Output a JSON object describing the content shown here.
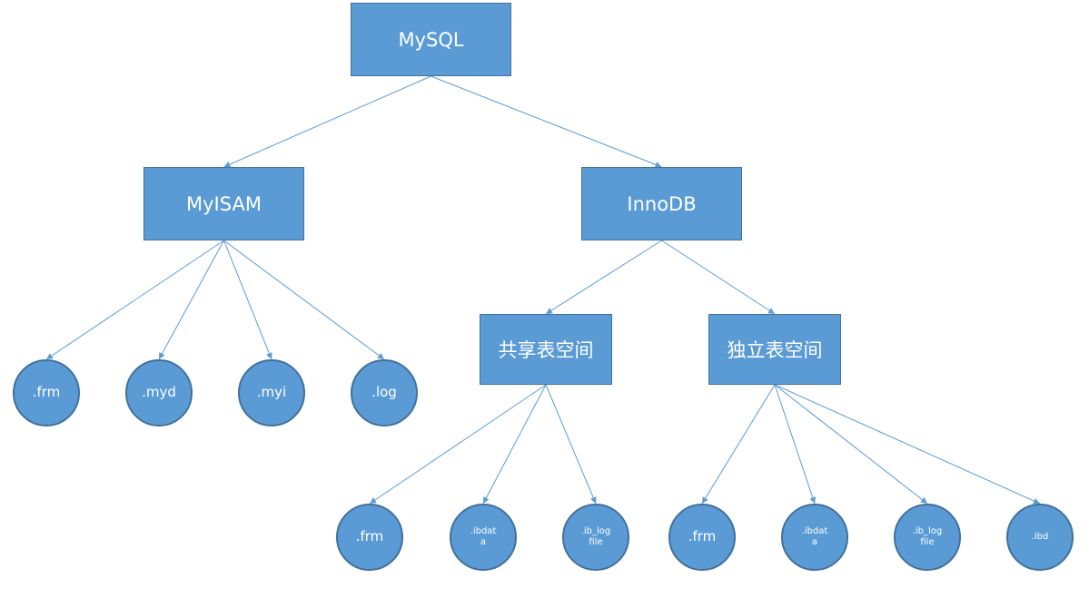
{
  "diagram": {
    "colors": {
      "fill": "#5B9BD5",
      "border": "#41719C",
      "text": "#FFFFFF",
      "edge": "#5B9BD5"
    },
    "nodes": {
      "mysql": {
        "label": "MySQL"
      },
      "myisam": {
        "label": "MyISAM"
      },
      "innodb": {
        "label": "InnoDB"
      },
      "shared_tablespace": {
        "label": "共享表空间"
      },
      "independent_tablespace": {
        "label": "独立表空间"
      },
      "myisam_frm": {
        "label": ".frm"
      },
      "myisam_myd": {
        "label": ".myd"
      },
      "myisam_myi": {
        "label": ".myi"
      },
      "myisam_log": {
        "label": ".log"
      },
      "shared_frm": {
        "label": ".frm"
      },
      "shared_ibdata": {
        "label": ".ibdat\na"
      },
      "shared_ib_logfile": {
        "label": ".ib_log\nfile"
      },
      "independent_frm": {
        "label": ".frm"
      },
      "independent_ibdata": {
        "label": ".ibdat\na"
      },
      "independent_ib_logfile": {
        "label": ".ib_log\nfile"
      },
      "independent_ibd": {
        "label": ".ibd"
      }
    },
    "edges": [
      [
        "mysql",
        "myisam"
      ],
      [
        "mysql",
        "innodb"
      ],
      [
        "myisam",
        "myisam_frm"
      ],
      [
        "myisam",
        "myisam_myd"
      ],
      [
        "myisam",
        "myisam_myi"
      ],
      [
        "myisam",
        "myisam_log"
      ],
      [
        "innodb",
        "shared_tablespace"
      ],
      [
        "innodb",
        "independent_tablespace"
      ],
      [
        "shared_tablespace",
        "shared_frm"
      ],
      [
        "shared_tablespace",
        "shared_ibdata"
      ],
      [
        "shared_tablespace",
        "shared_ib_logfile"
      ],
      [
        "independent_tablespace",
        "independent_frm"
      ],
      [
        "independent_tablespace",
        "independent_ibdata"
      ],
      [
        "independent_tablespace",
        "independent_ib_logfile"
      ],
      [
        "independent_tablespace",
        "independent_ibd"
      ]
    ]
  }
}
